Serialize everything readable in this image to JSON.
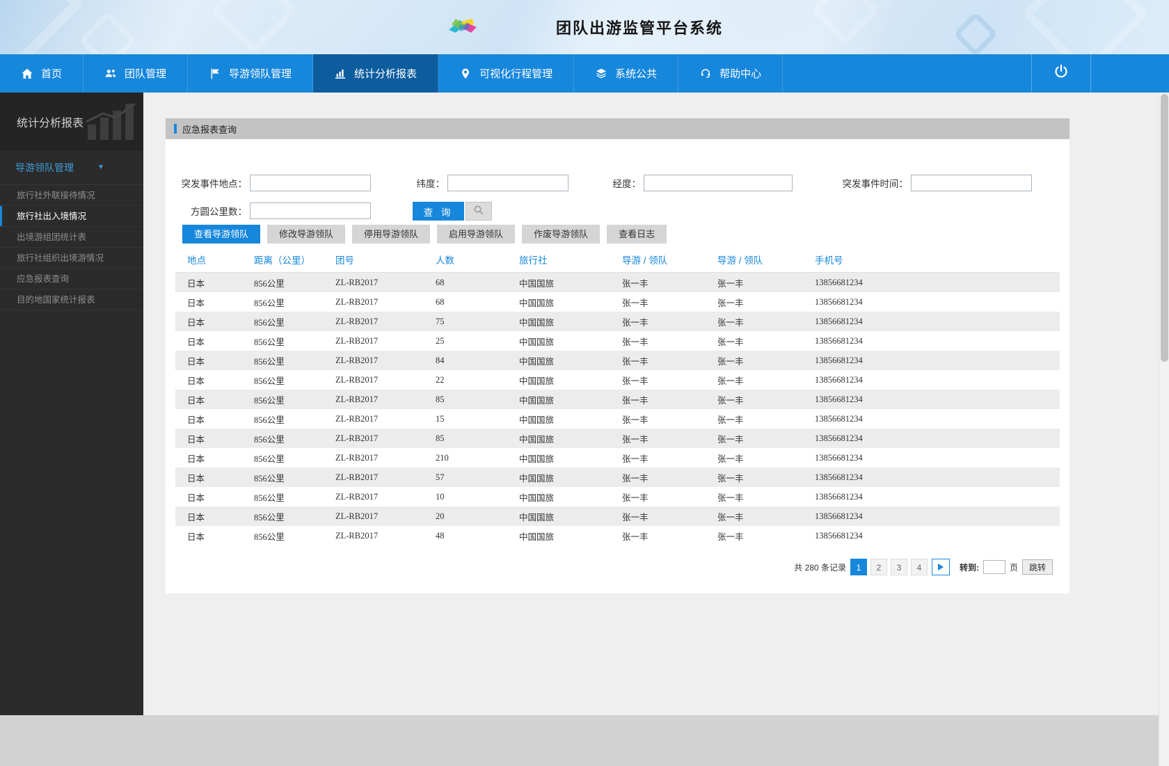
{
  "banner": {
    "title": "团队出游监管平台系统"
  },
  "nav": {
    "items": [
      {
        "label": "首页",
        "icon": "home-icon"
      },
      {
        "label": "团队管理",
        "icon": "team-icon"
      },
      {
        "label": "导游领队管理",
        "icon": "guide-flag-icon"
      },
      {
        "label": "统计分析报表",
        "icon": "chart-icon"
      },
      {
        "label": "可视化行程管理",
        "icon": "itinerary-pin-icon"
      },
      {
        "label": "系统公共",
        "icon": "layers-icon"
      },
      {
        "label": "帮助中心",
        "icon": "help-headset-icon"
      }
    ],
    "active_index": 3
  },
  "sidebar": {
    "section_title": "统计分析报表",
    "group_label": "导游领队管理",
    "items": [
      {
        "label": "旅行社外联接待情况",
        "active": false
      },
      {
        "label": "旅行社出入境情况",
        "active": true
      },
      {
        "label": "出境游组团统计表",
        "active": false
      },
      {
        "label": "旅行社组织出境游情况",
        "active": false
      },
      {
        "label": "应急报表查询",
        "active": false
      },
      {
        "label": "目的地国家统计报表",
        "active": false
      }
    ]
  },
  "panel": {
    "title": "应急报表查询",
    "form": {
      "incident_location_label": "突发事件地点：",
      "latitude_label": "纬度：",
      "longitude_label": "经度：",
      "incident_time_label": "突发事件时间：",
      "radius_km_label": "方圆公里数：",
      "query_button_label": "查 询"
    },
    "tabs": [
      {
        "label": "查看导游领队",
        "active": true
      },
      {
        "label": "修改导游领队",
        "active": false
      },
      {
        "label": "停用导游领队",
        "active": false
      },
      {
        "label": "启用导游领队",
        "active": false
      },
      {
        "label": "作废导游领队",
        "active": false
      },
      {
        "label": "查看日志",
        "active": false
      }
    ],
    "table": {
      "columns": [
        "地点",
        "距离（公里）",
        "团号",
        "人数",
        "旅行社",
        "导游 / 领队",
        "导游 / 领队",
        "手机号"
      ],
      "rows": [
        [
          "日本",
          "856公里",
          "ZL-RB2017",
          "68",
          "中国国旅",
          "张一丰",
          "张一丰",
          "13856681234"
        ],
        [
          "日本",
          "856公里",
          "ZL-RB2017",
          "68",
          "中国国旅",
          "张一丰",
          "张一丰",
          "13856681234"
        ],
        [
          "日本",
          "856公里",
          "ZL-RB2017",
          "75",
          "中国国旅",
          "张一丰",
          "张一丰",
          "13856681234"
        ],
        [
          "日本",
          "856公里",
          "ZL-RB2017",
          "25",
          "中国国旅",
          "张一丰",
          "张一丰",
          "13856681234"
        ],
        [
          "日本",
          "856公里",
          "ZL-RB2017",
          "84",
          "中国国旅",
          "张一丰",
          "张一丰",
          "13856681234"
        ],
        [
          "日本",
          "856公里",
          "ZL-RB2017",
          "22",
          "中国国旅",
          "张一丰",
          "张一丰",
          "13856681234"
        ],
        [
          "日本",
          "856公里",
          "ZL-RB2017",
          "85",
          "中国国旅",
          "张一丰",
          "张一丰",
          "13856681234"
        ],
        [
          "日本",
          "856公里",
          "ZL-RB2017",
          "15",
          "中国国旅",
          "张一丰",
          "张一丰",
          "13856681234"
        ],
        [
          "日本",
          "856公里",
          "ZL-RB2017",
          "85",
          "中国国旅",
          "张一丰",
          "张一丰",
          "13856681234"
        ],
        [
          "日本",
          "856公里",
          "ZL-RB2017",
          "210",
          "中国国旅",
          "张一丰",
          "张一丰",
          "13856681234"
        ],
        [
          "日本",
          "856公里",
          "ZL-RB2017",
          "57",
          "中国国旅",
          "张一丰",
          "张一丰",
          "13856681234"
        ],
        [
          "日本",
          "856公里",
          "ZL-RB2017",
          "10",
          "中国国旅",
          "张一丰",
          "张一丰",
          "13856681234"
        ],
        [
          "日本",
          "856公里",
          "ZL-RB2017",
          "20",
          "中国国旅",
          "张一丰",
          "张一丰",
          "13856681234"
        ],
        [
          "日本",
          "856公里",
          "ZL-RB2017",
          "48",
          "中国国旅",
          "张一丰",
          "张一丰",
          "13856681234"
        ]
      ]
    },
    "pagination": {
      "total_text": "共 280 条记录",
      "pages": [
        "1",
        "2",
        "3",
        "4"
      ],
      "active_page": "1",
      "goto_label": "转到:",
      "page_unit_label": "页",
      "jump_button_label": "跳转"
    }
  }
}
